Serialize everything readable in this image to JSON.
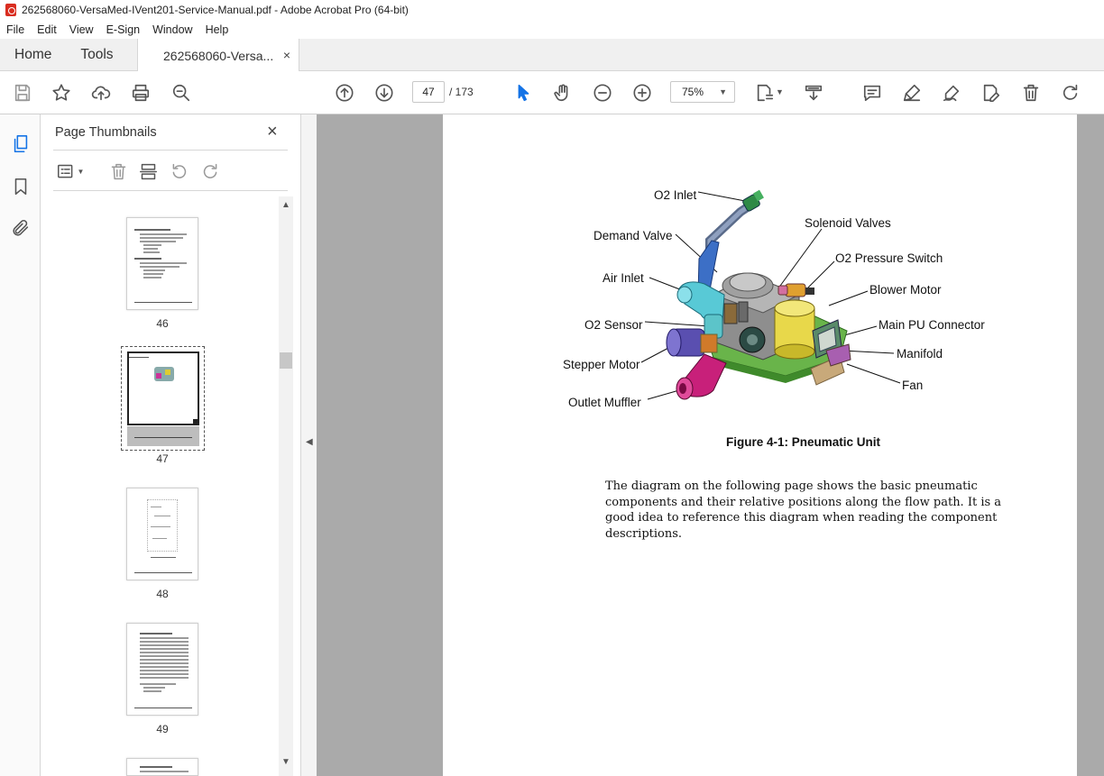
{
  "window": {
    "title": "262568060-VersaMed-IVent201-Service-Manual.pdf - Adobe Acrobat Pro (64-bit)"
  },
  "menu": [
    "File",
    "Edit",
    "View",
    "E-Sign",
    "Window",
    "Help"
  ],
  "tabs": {
    "home": "Home",
    "tools": "Tools",
    "document": "262568060-Versa...",
    "close": "×"
  },
  "toolbar": {
    "current_page": "47",
    "total_pages": "/ 173",
    "zoom": "75%"
  },
  "thumbnails": {
    "title": "Page Thumbnails",
    "close": "×",
    "pages": [
      "46",
      "47",
      "48",
      "49"
    ]
  },
  "document": {
    "labels": {
      "o2_inlet": "O2 Inlet",
      "solenoid_valves": "Solenoid Valves",
      "demand_valve": "Demand Valve",
      "o2_pressure_switch": "O2 Pressure Switch",
      "air_inlet": "Air Inlet",
      "blower_motor": "Blower Motor",
      "o2_sensor": "O2 Sensor",
      "main_pu_connector": "Main PU Connector",
      "manifold": "Manifold",
      "stepper_motor": "Stepper Motor",
      "fan": "Fan",
      "outlet_muffler": "Outlet Muffler"
    },
    "figure_caption": "Figure 4-1: Pneumatic Unit",
    "paragraph": "The diagram on the following page shows the basic pneumatic components and their relative positions along the flow path. It is a good idea to reference this diagram when reading the component descriptions."
  },
  "colors": {
    "accent_pdf": "#d92d20",
    "select_tool": "#1473e6",
    "doc_background": "#aaaaaa"
  }
}
